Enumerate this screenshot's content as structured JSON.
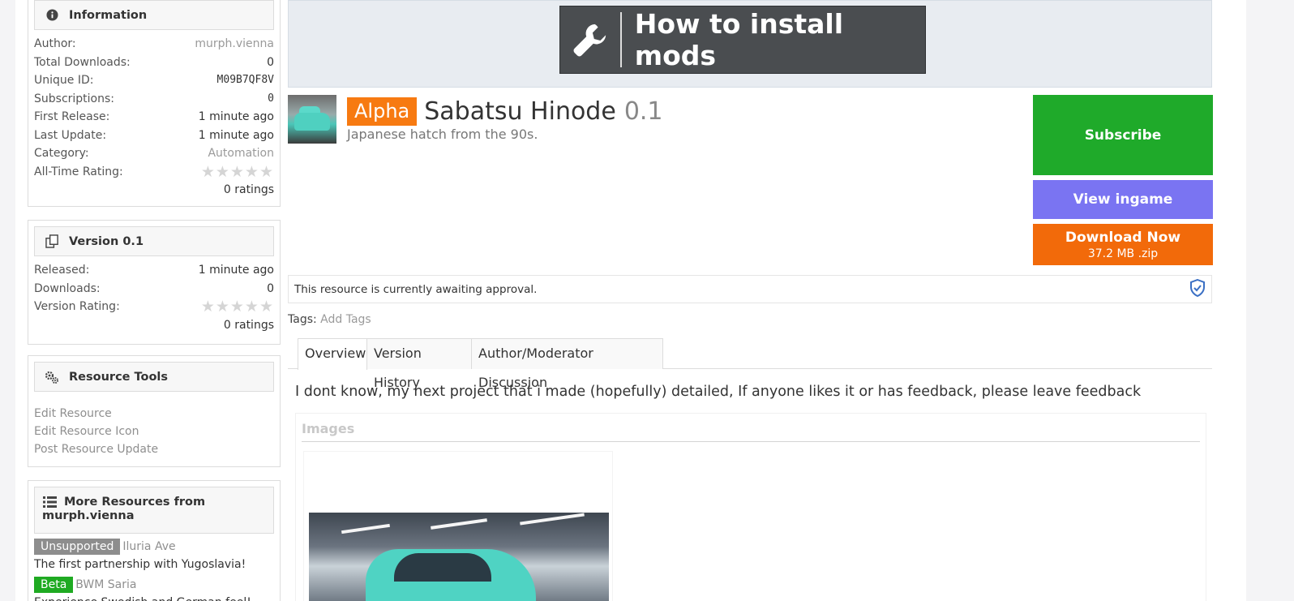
{
  "sidebar": {
    "info": {
      "title": "Information",
      "author_label": "Author:",
      "author": "murph.vienna",
      "downloads_label": "Total Downloads:",
      "downloads": "0",
      "uid_label": "Unique ID:",
      "uid": "M09B7QF8V",
      "subs_label": "Subscriptions:",
      "subs": "0",
      "first_label": "First Release:",
      "first": "1 minute ago",
      "last_label": "Last Update:",
      "last": "1 minute ago",
      "category_label": "Category:",
      "category": "Automation",
      "rating_label": "All-Time Rating:",
      "rating_count": "0 ratings"
    },
    "version": {
      "title": "Version 0.1",
      "released_label": "Released:",
      "released": "1 minute ago",
      "downloads_label": "Downloads:",
      "downloads": "0",
      "rating_label": "Version Rating:",
      "rating_count": "0 ratings"
    },
    "tools": {
      "title": "Resource Tools",
      "items": [
        "Edit Resource",
        "Edit Resource Icon",
        "Post Resource Update"
      ]
    },
    "more": {
      "title_line1": "More Resources from",
      "title_line2": "murph.vienna",
      "items": [
        {
          "badge": "Unsupported",
          "name": "Iluria Ave",
          "desc": "The first partnership with Yugoslavia!"
        },
        {
          "badge": "Beta",
          "name": "BWM Saria",
          "desc": "Experience Swedish and German feel!"
        }
      ]
    }
  },
  "banner": {
    "text": "How to install mods"
  },
  "resource": {
    "badge": "Alpha",
    "name": "Sabatsu Hinode",
    "version": "0.1",
    "tagline": "Japanese hatch from the 90s."
  },
  "actions": {
    "subscribe": "Subscribe",
    "view": "View ingame",
    "download": "Download Now",
    "download_size": "37.2 MB .zip"
  },
  "approval": {
    "text": "This resource is currently awaiting approval."
  },
  "tags": {
    "label": "Tags:",
    "add": "Add Tags"
  },
  "tabs": [
    "Overview",
    "Version History",
    "Author/Moderator Discussion"
  ],
  "description": "I dont know, my next project that i made (hopefully) detailed, If anyone likes it or has feedback, please leave feedback",
  "images": {
    "title": "Images"
  },
  "colors": {
    "subscribe": "#1faa2a",
    "view": "#7a74f2",
    "download": "#f26a0a",
    "alpha_badge": "#f77a11"
  }
}
